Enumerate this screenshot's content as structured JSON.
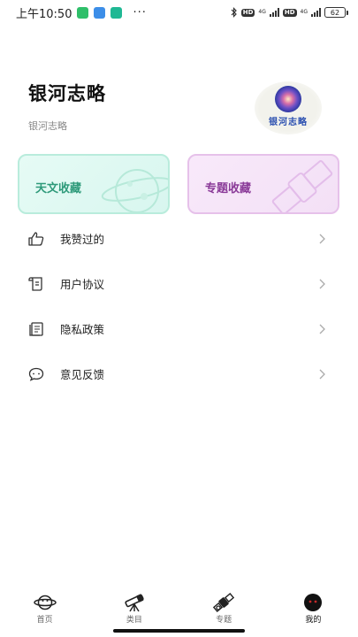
{
  "status_bar": {
    "time": "上午10:50",
    "dots": "···",
    "hd": "HD",
    "network": "4G",
    "battery": "62",
    "app_icon_colors": [
      "#2fbf6a",
      "#3c8ee8",
      "#1fb894"
    ]
  },
  "profile": {
    "title": "银河志略",
    "subtitle": "银河志略",
    "logo_text": "银河志略"
  },
  "collections": {
    "astronomy_label": "天文收藏",
    "topic_label": "专题收藏"
  },
  "menu": {
    "items": [
      {
        "label": "我赞过的",
        "icon": "thumbs-up-icon"
      },
      {
        "label": "用户协议",
        "icon": "scroll-icon"
      },
      {
        "label": "隐私政策",
        "icon": "document-icon"
      },
      {
        "label": "意见反馈",
        "icon": "chat-bubble-icon"
      }
    ]
  },
  "nav": {
    "items": [
      {
        "label": "首页",
        "icon": "planet-icon"
      },
      {
        "label": "类目",
        "icon": "telescope-icon"
      },
      {
        "label": "专题",
        "icon": "satellite-icon"
      },
      {
        "label": "我的",
        "icon": "alien-avatar-icon",
        "active": true
      }
    ]
  },
  "colors": {
    "astronomy_card": "#d8f6ef",
    "astronomy_text": "#2e9a7a",
    "topic_card": "#f3e0f6",
    "topic_text": "#8a3a98"
  }
}
